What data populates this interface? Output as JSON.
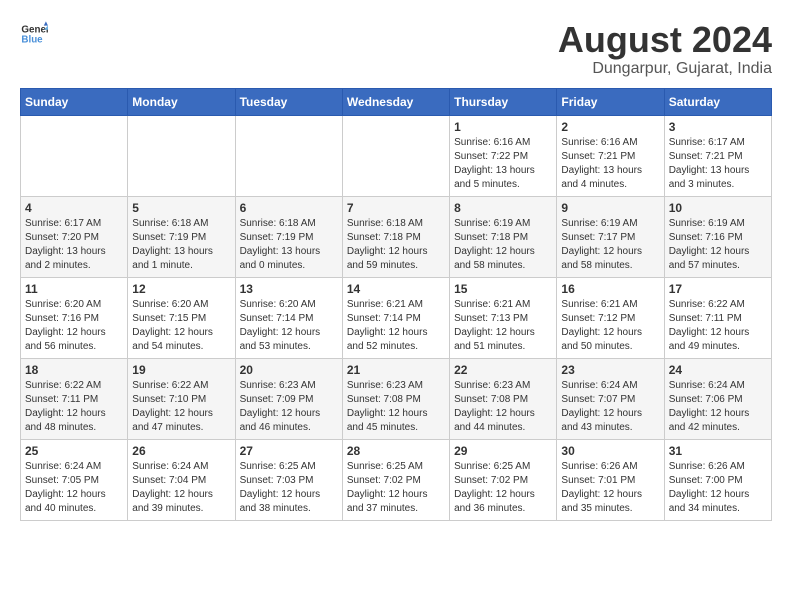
{
  "header": {
    "logo_general": "General",
    "logo_blue": "Blue",
    "month_year": "August 2024",
    "location": "Dungarpur, Gujarat, India"
  },
  "days_of_week": [
    "Sunday",
    "Monday",
    "Tuesday",
    "Wednesday",
    "Thursday",
    "Friday",
    "Saturday"
  ],
  "weeks": [
    [
      {
        "num": "",
        "info": ""
      },
      {
        "num": "",
        "info": ""
      },
      {
        "num": "",
        "info": ""
      },
      {
        "num": "",
        "info": ""
      },
      {
        "num": "1",
        "info": "Sunrise: 6:16 AM\nSunset: 7:22 PM\nDaylight: 13 hours\nand 5 minutes."
      },
      {
        "num": "2",
        "info": "Sunrise: 6:16 AM\nSunset: 7:21 PM\nDaylight: 13 hours\nand 4 minutes."
      },
      {
        "num": "3",
        "info": "Sunrise: 6:17 AM\nSunset: 7:21 PM\nDaylight: 13 hours\nand 3 minutes."
      }
    ],
    [
      {
        "num": "4",
        "info": "Sunrise: 6:17 AM\nSunset: 7:20 PM\nDaylight: 13 hours\nand 2 minutes."
      },
      {
        "num": "5",
        "info": "Sunrise: 6:18 AM\nSunset: 7:19 PM\nDaylight: 13 hours\nand 1 minute."
      },
      {
        "num": "6",
        "info": "Sunrise: 6:18 AM\nSunset: 7:19 PM\nDaylight: 13 hours\nand 0 minutes."
      },
      {
        "num": "7",
        "info": "Sunrise: 6:18 AM\nSunset: 7:18 PM\nDaylight: 12 hours\nand 59 minutes."
      },
      {
        "num": "8",
        "info": "Sunrise: 6:19 AM\nSunset: 7:18 PM\nDaylight: 12 hours\nand 58 minutes."
      },
      {
        "num": "9",
        "info": "Sunrise: 6:19 AM\nSunset: 7:17 PM\nDaylight: 12 hours\nand 58 minutes."
      },
      {
        "num": "10",
        "info": "Sunrise: 6:19 AM\nSunset: 7:16 PM\nDaylight: 12 hours\nand 57 minutes."
      }
    ],
    [
      {
        "num": "11",
        "info": "Sunrise: 6:20 AM\nSunset: 7:16 PM\nDaylight: 12 hours\nand 56 minutes."
      },
      {
        "num": "12",
        "info": "Sunrise: 6:20 AM\nSunset: 7:15 PM\nDaylight: 12 hours\nand 54 minutes."
      },
      {
        "num": "13",
        "info": "Sunrise: 6:20 AM\nSunset: 7:14 PM\nDaylight: 12 hours\nand 53 minutes."
      },
      {
        "num": "14",
        "info": "Sunrise: 6:21 AM\nSunset: 7:14 PM\nDaylight: 12 hours\nand 52 minutes."
      },
      {
        "num": "15",
        "info": "Sunrise: 6:21 AM\nSunset: 7:13 PM\nDaylight: 12 hours\nand 51 minutes."
      },
      {
        "num": "16",
        "info": "Sunrise: 6:21 AM\nSunset: 7:12 PM\nDaylight: 12 hours\nand 50 minutes."
      },
      {
        "num": "17",
        "info": "Sunrise: 6:22 AM\nSunset: 7:11 PM\nDaylight: 12 hours\nand 49 minutes."
      }
    ],
    [
      {
        "num": "18",
        "info": "Sunrise: 6:22 AM\nSunset: 7:11 PM\nDaylight: 12 hours\nand 48 minutes."
      },
      {
        "num": "19",
        "info": "Sunrise: 6:22 AM\nSunset: 7:10 PM\nDaylight: 12 hours\nand 47 minutes."
      },
      {
        "num": "20",
        "info": "Sunrise: 6:23 AM\nSunset: 7:09 PM\nDaylight: 12 hours\nand 46 minutes."
      },
      {
        "num": "21",
        "info": "Sunrise: 6:23 AM\nSunset: 7:08 PM\nDaylight: 12 hours\nand 45 minutes."
      },
      {
        "num": "22",
        "info": "Sunrise: 6:23 AM\nSunset: 7:08 PM\nDaylight: 12 hours\nand 44 minutes."
      },
      {
        "num": "23",
        "info": "Sunrise: 6:24 AM\nSunset: 7:07 PM\nDaylight: 12 hours\nand 43 minutes."
      },
      {
        "num": "24",
        "info": "Sunrise: 6:24 AM\nSunset: 7:06 PM\nDaylight: 12 hours\nand 42 minutes."
      }
    ],
    [
      {
        "num": "25",
        "info": "Sunrise: 6:24 AM\nSunset: 7:05 PM\nDaylight: 12 hours\nand 40 minutes."
      },
      {
        "num": "26",
        "info": "Sunrise: 6:24 AM\nSunset: 7:04 PM\nDaylight: 12 hours\nand 39 minutes."
      },
      {
        "num": "27",
        "info": "Sunrise: 6:25 AM\nSunset: 7:03 PM\nDaylight: 12 hours\nand 38 minutes."
      },
      {
        "num": "28",
        "info": "Sunrise: 6:25 AM\nSunset: 7:02 PM\nDaylight: 12 hours\nand 37 minutes."
      },
      {
        "num": "29",
        "info": "Sunrise: 6:25 AM\nSunset: 7:02 PM\nDaylight: 12 hours\nand 36 minutes."
      },
      {
        "num": "30",
        "info": "Sunrise: 6:26 AM\nSunset: 7:01 PM\nDaylight: 12 hours\nand 35 minutes."
      },
      {
        "num": "31",
        "info": "Sunrise: 6:26 AM\nSunset: 7:00 PM\nDaylight: 12 hours\nand 34 minutes."
      }
    ]
  ]
}
